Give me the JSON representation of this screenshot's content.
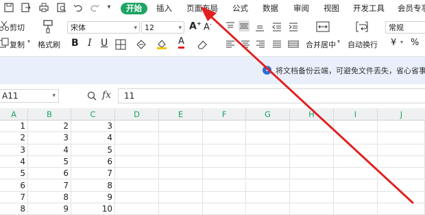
{
  "tabs": [
    "开始",
    "插入",
    "页面布局",
    "公式",
    "数据",
    "审阅",
    "视图",
    "开发工具",
    "会员专享"
  ],
  "quick_access_icons": [
    "save-icon",
    "export-icon",
    "print-icon",
    "preview-icon",
    "undo-icon",
    "redo-icon",
    "chevron-down-icon"
  ],
  "ribbon": {
    "cut_label": "剪切",
    "copy_label": "复制",
    "format_painter_label": "格式刷",
    "font_name": "宋体",
    "font_size": "12",
    "merge_label": "合并居中",
    "wrap_label": "自动换行",
    "number_format": "常规",
    "currency_symbol": "¥",
    "percent_symbol": "%"
  },
  "notification": "将文档备份云端，可避免文件丢失，省心省事",
  "formula_bar": {
    "name_box": "A11",
    "fx_label": "fx",
    "value": "11"
  },
  "columns": [
    "A",
    "B",
    "C",
    "D",
    "E",
    "F",
    "G",
    "H",
    "I",
    "J"
  ],
  "rows": [
    [
      "1",
      "2",
      "3"
    ],
    [
      "2",
      "3",
      "4"
    ],
    [
      "3",
      "4",
      "5"
    ],
    [
      "4",
      "5",
      "6"
    ],
    [
      "5",
      "6",
      "7"
    ],
    [
      "6",
      "7",
      "8"
    ],
    [
      "7",
      "8",
      "9"
    ],
    [
      "8",
      "9",
      "10"
    ]
  ],
  "colors": {
    "accent": "#1fa463",
    "arrow": "#e02020",
    "notify_bg": "#e9f0fb"
  }
}
